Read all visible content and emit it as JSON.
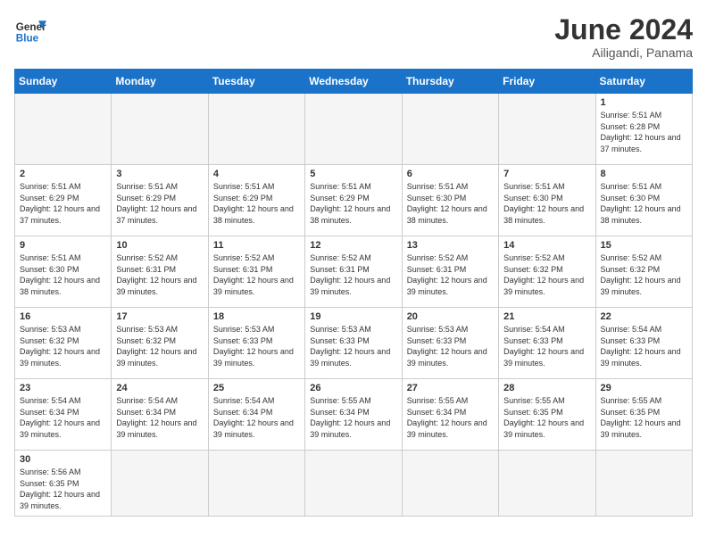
{
  "header": {
    "logo_general": "General",
    "logo_blue": "Blue",
    "title": "June 2024",
    "subtitle": "Ailigandi, Panama"
  },
  "days_of_week": [
    "Sunday",
    "Monday",
    "Tuesday",
    "Wednesday",
    "Thursday",
    "Friday",
    "Saturday"
  ],
  "weeks": [
    [
      {
        "day": "",
        "info": "",
        "empty": true
      },
      {
        "day": "",
        "info": "",
        "empty": true
      },
      {
        "day": "",
        "info": "",
        "empty": true
      },
      {
        "day": "",
        "info": "",
        "empty": true
      },
      {
        "day": "",
        "info": "",
        "empty": true
      },
      {
        "day": "",
        "info": "",
        "empty": true
      },
      {
        "day": "1",
        "info": "Sunrise: 5:51 AM\nSunset: 6:28 PM\nDaylight: 12 hours and 37 minutes.",
        "empty": false
      }
    ],
    [
      {
        "day": "2",
        "info": "Sunrise: 5:51 AM\nSunset: 6:29 PM\nDaylight: 12 hours and 37 minutes.",
        "empty": false
      },
      {
        "day": "3",
        "info": "Sunrise: 5:51 AM\nSunset: 6:29 PM\nDaylight: 12 hours and 37 minutes.",
        "empty": false
      },
      {
        "day": "4",
        "info": "Sunrise: 5:51 AM\nSunset: 6:29 PM\nDaylight: 12 hours and 38 minutes.",
        "empty": false
      },
      {
        "day": "5",
        "info": "Sunrise: 5:51 AM\nSunset: 6:29 PM\nDaylight: 12 hours and 38 minutes.",
        "empty": false
      },
      {
        "day": "6",
        "info": "Sunrise: 5:51 AM\nSunset: 6:30 PM\nDaylight: 12 hours and 38 minutes.",
        "empty": false
      },
      {
        "day": "7",
        "info": "Sunrise: 5:51 AM\nSunset: 6:30 PM\nDaylight: 12 hours and 38 minutes.",
        "empty": false
      },
      {
        "day": "8",
        "info": "Sunrise: 5:51 AM\nSunset: 6:30 PM\nDaylight: 12 hours and 38 minutes.",
        "empty": false
      }
    ],
    [
      {
        "day": "9",
        "info": "Sunrise: 5:51 AM\nSunset: 6:30 PM\nDaylight: 12 hours and 38 minutes.",
        "empty": false
      },
      {
        "day": "10",
        "info": "Sunrise: 5:52 AM\nSunset: 6:31 PM\nDaylight: 12 hours and 39 minutes.",
        "empty": false
      },
      {
        "day": "11",
        "info": "Sunrise: 5:52 AM\nSunset: 6:31 PM\nDaylight: 12 hours and 39 minutes.",
        "empty": false
      },
      {
        "day": "12",
        "info": "Sunrise: 5:52 AM\nSunset: 6:31 PM\nDaylight: 12 hours and 39 minutes.",
        "empty": false
      },
      {
        "day": "13",
        "info": "Sunrise: 5:52 AM\nSunset: 6:31 PM\nDaylight: 12 hours and 39 minutes.",
        "empty": false
      },
      {
        "day": "14",
        "info": "Sunrise: 5:52 AM\nSunset: 6:32 PM\nDaylight: 12 hours and 39 minutes.",
        "empty": false
      },
      {
        "day": "15",
        "info": "Sunrise: 5:52 AM\nSunset: 6:32 PM\nDaylight: 12 hours and 39 minutes.",
        "empty": false
      }
    ],
    [
      {
        "day": "16",
        "info": "Sunrise: 5:53 AM\nSunset: 6:32 PM\nDaylight: 12 hours and 39 minutes.",
        "empty": false
      },
      {
        "day": "17",
        "info": "Sunrise: 5:53 AM\nSunset: 6:32 PM\nDaylight: 12 hours and 39 minutes.",
        "empty": false
      },
      {
        "day": "18",
        "info": "Sunrise: 5:53 AM\nSunset: 6:33 PM\nDaylight: 12 hours and 39 minutes.",
        "empty": false
      },
      {
        "day": "19",
        "info": "Sunrise: 5:53 AM\nSunset: 6:33 PM\nDaylight: 12 hours and 39 minutes.",
        "empty": false
      },
      {
        "day": "20",
        "info": "Sunrise: 5:53 AM\nSunset: 6:33 PM\nDaylight: 12 hours and 39 minutes.",
        "empty": false
      },
      {
        "day": "21",
        "info": "Sunrise: 5:54 AM\nSunset: 6:33 PM\nDaylight: 12 hours and 39 minutes.",
        "empty": false
      },
      {
        "day": "22",
        "info": "Sunrise: 5:54 AM\nSunset: 6:33 PM\nDaylight: 12 hours and 39 minutes.",
        "empty": false
      }
    ],
    [
      {
        "day": "23",
        "info": "Sunrise: 5:54 AM\nSunset: 6:34 PM\nDaylight: 12 hours and 39 minutes.",
        "empty": false
      },
      {
        "day": "24",
        "info": "Sunrise: 5:54 AM\nSunset: 6:34 PM\nDaylight: 12 hours and 39 minutes.",
        "empty": false
      },
      {
        "day": "25",
        "info": "Sunrise: 5:54 AM\nSunset: 6:34 PM\nDaylight: 12 hours and 39 minutes.",
        "empty": false
      },
      {
        "day": "26",
        "info": "Sunrise: 5:55 AM\nSunset: 6:34 PM\nDaylight: 12 hours and 39 minutes.",
        "empty": false
      },
      {
        "day": "27",
        "info": "Sunrise: 5:55 AM\nSunset: 6:34 PM\nDaylight: 12 hours and 39 minutes.",
        "empty": false
      },
      {
        "day": "28",
        "info": "Sunrise: 5:55 AM\nSunset: 6:35 PM\nDaylight: 12 hours and 39 minutes.",
        "empty": false
      },
      {
        "day": "29",
        "info": "Sunrise: 5:55 AM\nSunset: 6:35 PM\nDaylight: 12 hours and 39 minutes.",
        "empty": false
      }
    ],
    [
      {
        "day": "30",
        "info": "Sunrise: 5:56 AM\nSunset: 6:35 PM\nDaylight: 12 hours and 39 minutes.",
        "empty": false
      },
      {
        "day": "",
        "info": "",
        "empty": true
      },
      {
        "day": "",
        "info": "",
        "empty": true
      },
      {
        "day": "",
        "info": "",
        "empty": true
      },
      {
        "day": "",
        "info": "",
        "empty": true
      },
      {
        "day": "",
        "info": "",
        "empty": true
      },
      {
        "day": "",
        "info": "",
        "empty": true
      }
    ]
  ]
}
